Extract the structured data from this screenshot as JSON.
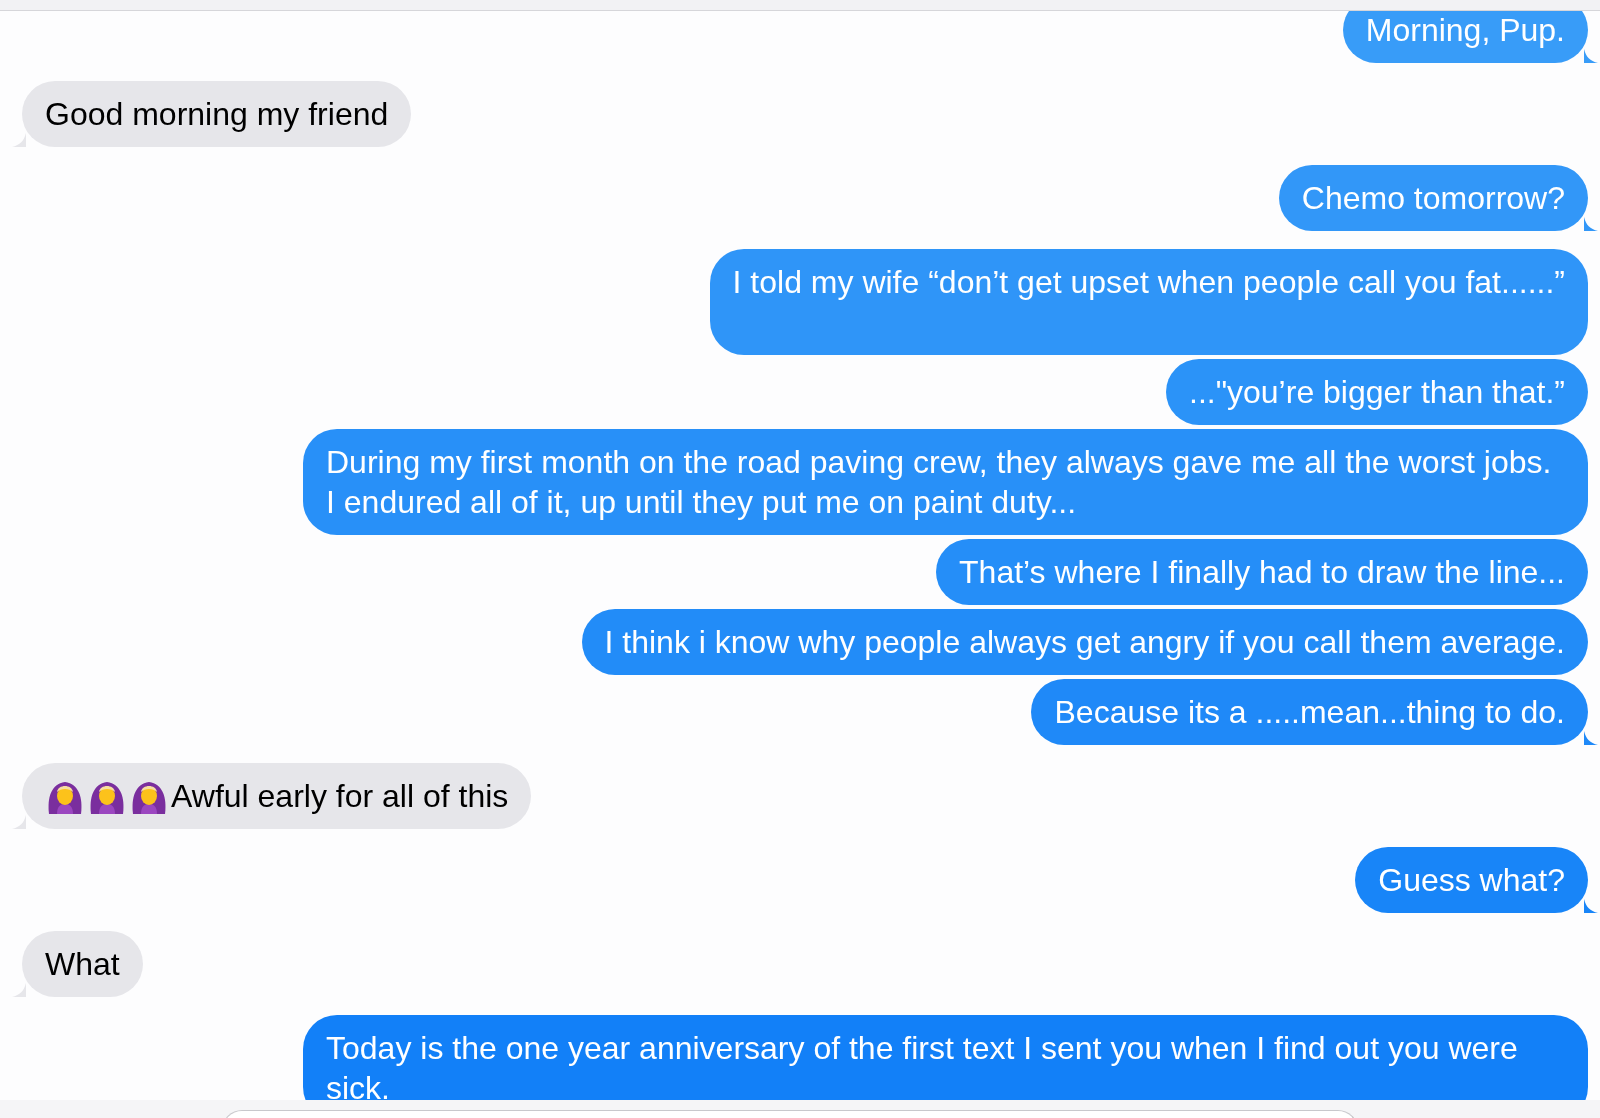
{
  "messages": [
    {
      "kind": "sent",
      "text": "Morning, Pup.",
      "tail": true
    },
    {
      "kind": "received",
      "text": "Good morning my friend",
      "tail": true
    },
    {
      "kind": "sent",
      "text": "Chemo tomorrow?",
      "tail": true
    },
    {
      "kind": "sent",
      "text": "I told my wife “don’t get upset when people call you fat......”",
      "tail": false,
      "blank_line": true
    },
    {
      "kind": "sent",
      "text": "...\"you’re bigger than that.”",
      "tail": false
    },
    {
      "kind": "sent",
      "text": "During my first month on the road paving crew, they always gave me all the worst jobs. I endured all of it, up until they put me on paint duty...",
      "tail": false
    },
    {
      "kind": "sent",
      "text": "That’s where I finally had to draw the line...",
      "tail": false
    },
    {
      "kind": "sent",
      "text": "I think i know why people always get angry if you call them average.",
      "tail": false
    },
    {
      "kind": "sent",
      "text": "Because its a .....mean...thing to do.",
      "tail": true
    },
    {
      "kind": "received",
      "text": "Awful early for all of this",
      "tail": true,
      "emojis": [
        {
          "kind": "woman-gesturing-ok"
        },
        {
          "kind": "woman-gesturing-ok"
        },
        {
          "kind": "woman-gesturing-ok"
        }
      ]
    },
    {
      "kind": "sent",
      "text": "Guess what?",
      "tail": true
    },
    {
      "kind": "received",
      "text": "What",
      "tail": true
    },
    {
      "kind": "sent",
      "text": "Today is the one year anniversary of the first text I sent you when I find out you were sick.",
      "tail": false
    }
  ]
}
